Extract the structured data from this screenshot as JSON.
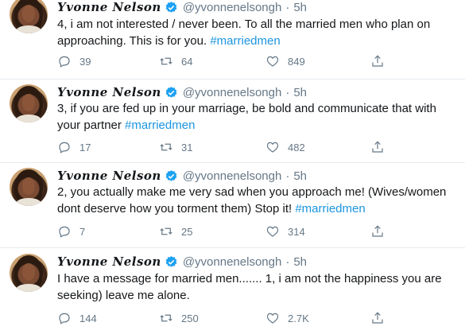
{
  "tweets": [
    {
      "author_name": "Yvonne Nelson",
      "handle": "@yvonnenelsongh",
      "separator": "·",
      "time": "5h",
      "text": "4, i am not interested / never been. To all the married men who plan on approaching. This is for you. ",
      "hashtag": "#marriedmen",
      "replies": "39",
      "retweets": "64",
      "likes": "849"
    },
    {
      "author_name": "Yvonne Nelson",
      "handle": "@yvonnenelsongh",
      "separator": "·",
      "time": "5h",
      "text": "3, if you are fed up in your marriage, be bold and communicate that with your partner ",
      "hashtag": "#marriedmen",
      "replies": "17",
      "retweets": "31",
      "likes": "482"
    },
    {
      "author_name": "Yvonne Nelson",
      "handle": "@yvonnenelsongh",
      "separator": "·",
      "time": "5h",
      "text": "2, you actually make me very sad when you approach me! (Wives/women dont deserve how you torment them) Stop it! ",
      "hashtag": "#marriedmen",
      "replies": "7",
      "retweets": "25",
      "likes": "314"
    },
    {
      "author_name": "Yvonne Nelson",
      "handle": "@yvonnenelsongh",
      "separator": "·",
      "time": "5h",
      "text": "I have a message for married men....... 1, i am not the happiness you are seeking) leave me alone.",
      "hashtag": "",
      "replies": "144",
      "retweets": "250",
      "likes": "2.7K"
    }
  ],
  "icons": {
    "reply": "reply-icon",
    "retweet": "retweet-icon",
    "like": "heart-icon",
    "share": "share-icon",
    "verified": "verified-badge-icon"
  },
  "colors": {
    "hashtag": "#1b95e0",
    "verified": "#1da1f2",
    "secondary_text": "#657786"
  }
}
